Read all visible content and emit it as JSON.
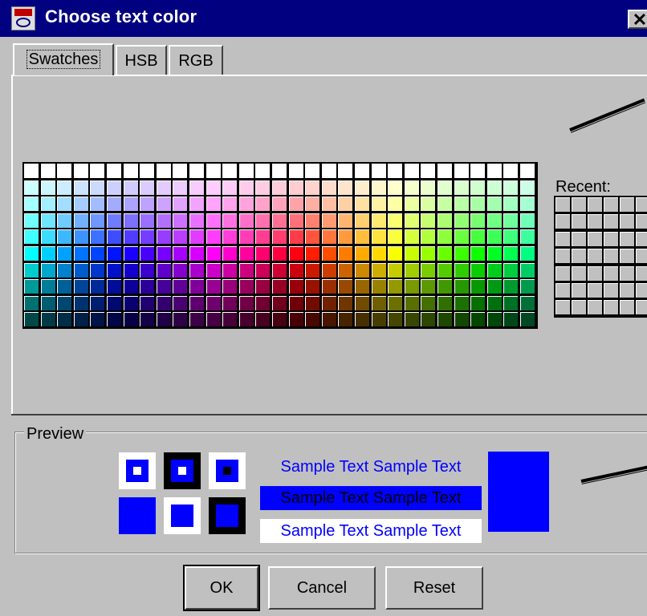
{
  "window": {
    "title": "Choose text color",
    "close_glyph": "✕"
  },
  "tabs": [
    {
      "label": "Swatches",
      "active": true
    },
    {
      "label": "HSB",
      "active": false
    },
    {
      "label": "RGB",
      "active": false
    }
  ],
  "swatches": {
    "recent_label": "Recent:"
  },
  "preview": {
    "label": "Preview",
    "sample_text": "Sample Text",
    "color": "#0000ff"
  },
  "buttons": {
    "ok": "OK",
    "cancel": "Cancel",
    "reset": "Reset"
  },
  "icons": {
    "title_icon": "java-coffee-cup-icon"
  },
  "colors": {
    "titlebar": "#000080",
    "dialog_bg": "#c0c0c0",
    "selected_text_color": "#0000ff"
  }
}
